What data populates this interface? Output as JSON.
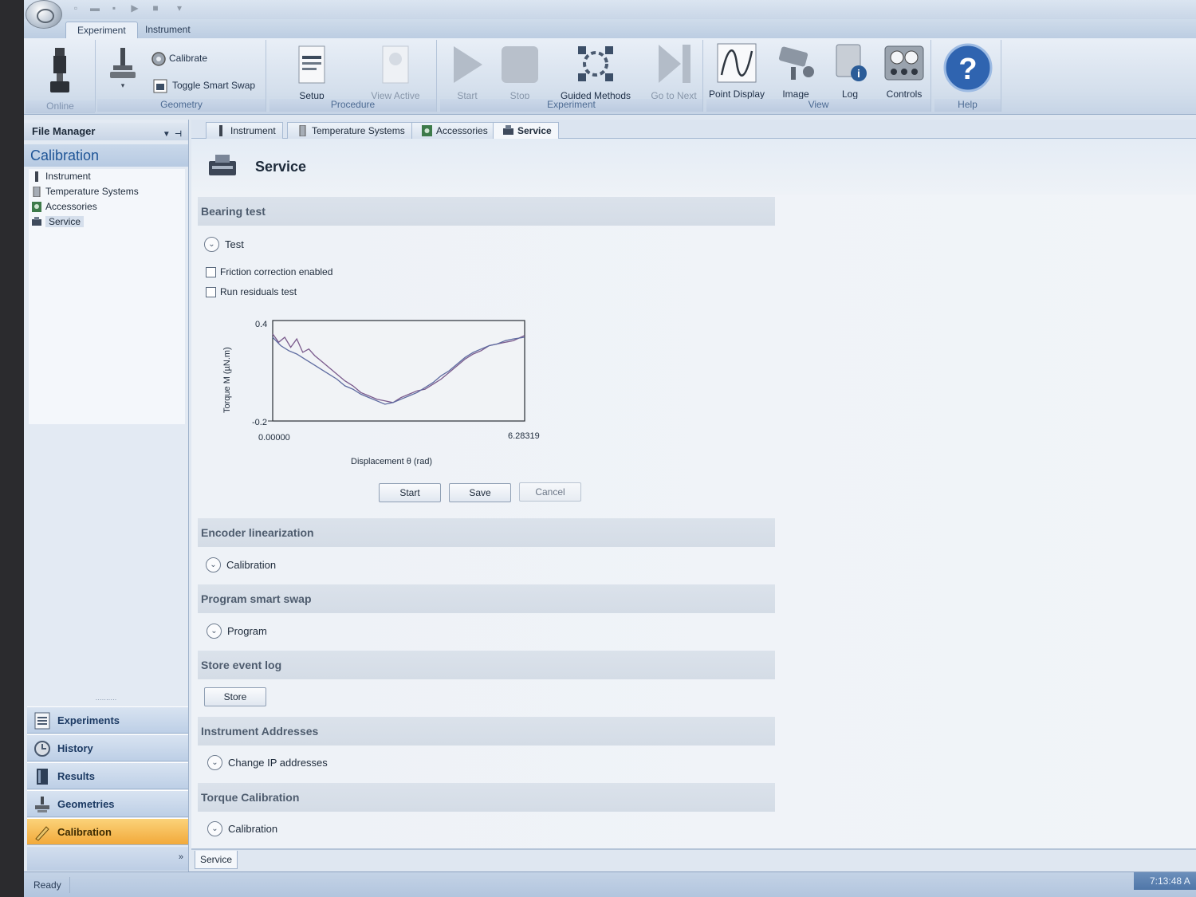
{
  "ribbon_tabs": [
    "Experiment",
    "Instrument"
  ],
  "ribbon": {
    "online": "Online",
    "calibrate": "Calibrate",
    "toggle_smart_swap": "Toggle Smart Swap",
    "geometry_group": "Geometry",
    "setup": "Setup",
    "view_active": "View Active",
    "procedure_group": "Procedure",
    "start": "Start",
    "stop": "Stop",
    "guided_methods": "Guided Methods",
    "go_to_next": "Go to Next",
    "experiment_group": "Experiment",
    "point_display": "Point Display",
    "image": "Image",
    "log": "Log",
    "controls": "Controls",
    "view_group": "View",
    "help": "Help"
  },
  "left_panel": {
    "file_manager": "File Manager",
    "calibration_title": "Calibration",
    "tree": [
      "Instrument",
      "Temperature Systems",
      "Accessories",
      "Service"
    ],
    "nav": [
      "Experiments",
      "History",
      "Results",
      "Geometries",
      "Calibration"
    ]
  },
  "doc_tabs": [
    "Instrument",
    "Temperature Systems",
    "Accessories",
    "Service"
  ],
  "service": {
    "title": "Service",
    "bearing_test": {
      "header": "Bearing test",
      "expander": "Test",
      "friction_label": "Friction correction enabled",
      "friction_checked": false,
      "residuals_label": "Run residuals test",
      "residuals_checked": false,
      "start": "Start",
      "save": "Save",
      "cancel": "Cancel"
    },
    "encoder": {
      "header": "Encoder linearization",
      "expander": "Calibration"
    },
    "smart_swap": {
      "header": "Program smart swap",
      "expander": "Program"
    },
    "event_log": {
      "header": "Store event log",
      "button": "Store"
    },
    "addresses": {
      "header": "Instrument Addresses",
      "expander": "Change IP addresses"
    },
    "torque": {
      "header": "Torque Calibration",
      "expander": "Calibration"
    }
  },
  "chart_data": {
    "type": "line",
    "xlabel": "Displacement θ (rad)",
    "ylabel": "Torque M (µN.m)",
    "xlim": [
      0.0,
      6.28319
    ],
    "ylim": [
      -0.2,
      0.4
    ],
    "x_tick_labels": [
      "0.00000",
      "6.28319"
    ],
    "y_tick_labels": [
      "0.4",
      "-0.2"
    ],
    "series": [
      {
        "x": [
          0.0,
          0.15,
          0.3,
          0.45,
          0.6,
          0.75,
          0.9,
          1.05,
          1.2,
          1.4,
          1.6,
          1.8,
          2.0,
          2.2,
          2.4,
          2.6,
          2.8,
          3.0,
          3.2,
          3.4,
          3.6,
          3.8,
          4.0,
          4.2,
          4.4,
          4.6,
          4.8,
          5.0,
          5.2,
          5.4,
          5.6,
          5.8,
          6.0,
          6.28
        ],
        "y": [
          0.32,
          0.27,
          0.3,
          0.24,
          0.29,
          0.21,
          0.23,
          0.19,
          0.16,
          0.12,
          0.08,
          0.04,
          0.01,
          -0.03,
          -0.05,
          -0.07,
          -0.08,
          -0.09,
          -0.06,
          -0.04,
          -0.02,
          -0.01,
          0.02,
          0.05,
          0.09,
          0.13,
          0.17,
          0.2,
          0.22,
          0.25,
          0.26,
          0.27,
          0.28,
          0.31
        ],
        "color": "#7a5a8c"
      },
      {
        "x": [
          0.0,
          0.2,
          0.4,
          0.6,
          0.8,
          1.0,
          1.2,
          1.4,
          1.6,
          1.8,
          2.0,
          2.2,
          2.4,
          2.6,
          2.8,
          3.0,
          3.2,
          3.4,
          3.6,
          3.8,
          4.0,
          4.2,
          4.4,
          4.6,
          4.8,
          5.0,
          5.2,
          5.4,
          5.6,
          5.8,
          6.0,
          6.28
        ],
        "y": [
          0.3,
          0.25,
          0.22,
          0.2,
          0.17,
          0.14,
          0.11,
          0.08,
          0.05,
          0.01,
          -0.01,
          -0.04,
          -0.06,
          -0.08,
          -0.1,
          -0.09,
          -0.07,
          -0.05,
          -0.03,
          0.0,
          0.03,
          0.07,
          0.1,
          0.14,
          0.18,
          0.21,
          0.23,
          0.25,
          0.26,
          0.28,
          0.29,
          0.3
        ],
        "color": "#5e6ba0"
      }
    ],
    "grid": false
  },
  "bottom_tab": "Service",
  "status": {
    "text": "Ready",
    "clock": "7:13:48 A"
  }
}
